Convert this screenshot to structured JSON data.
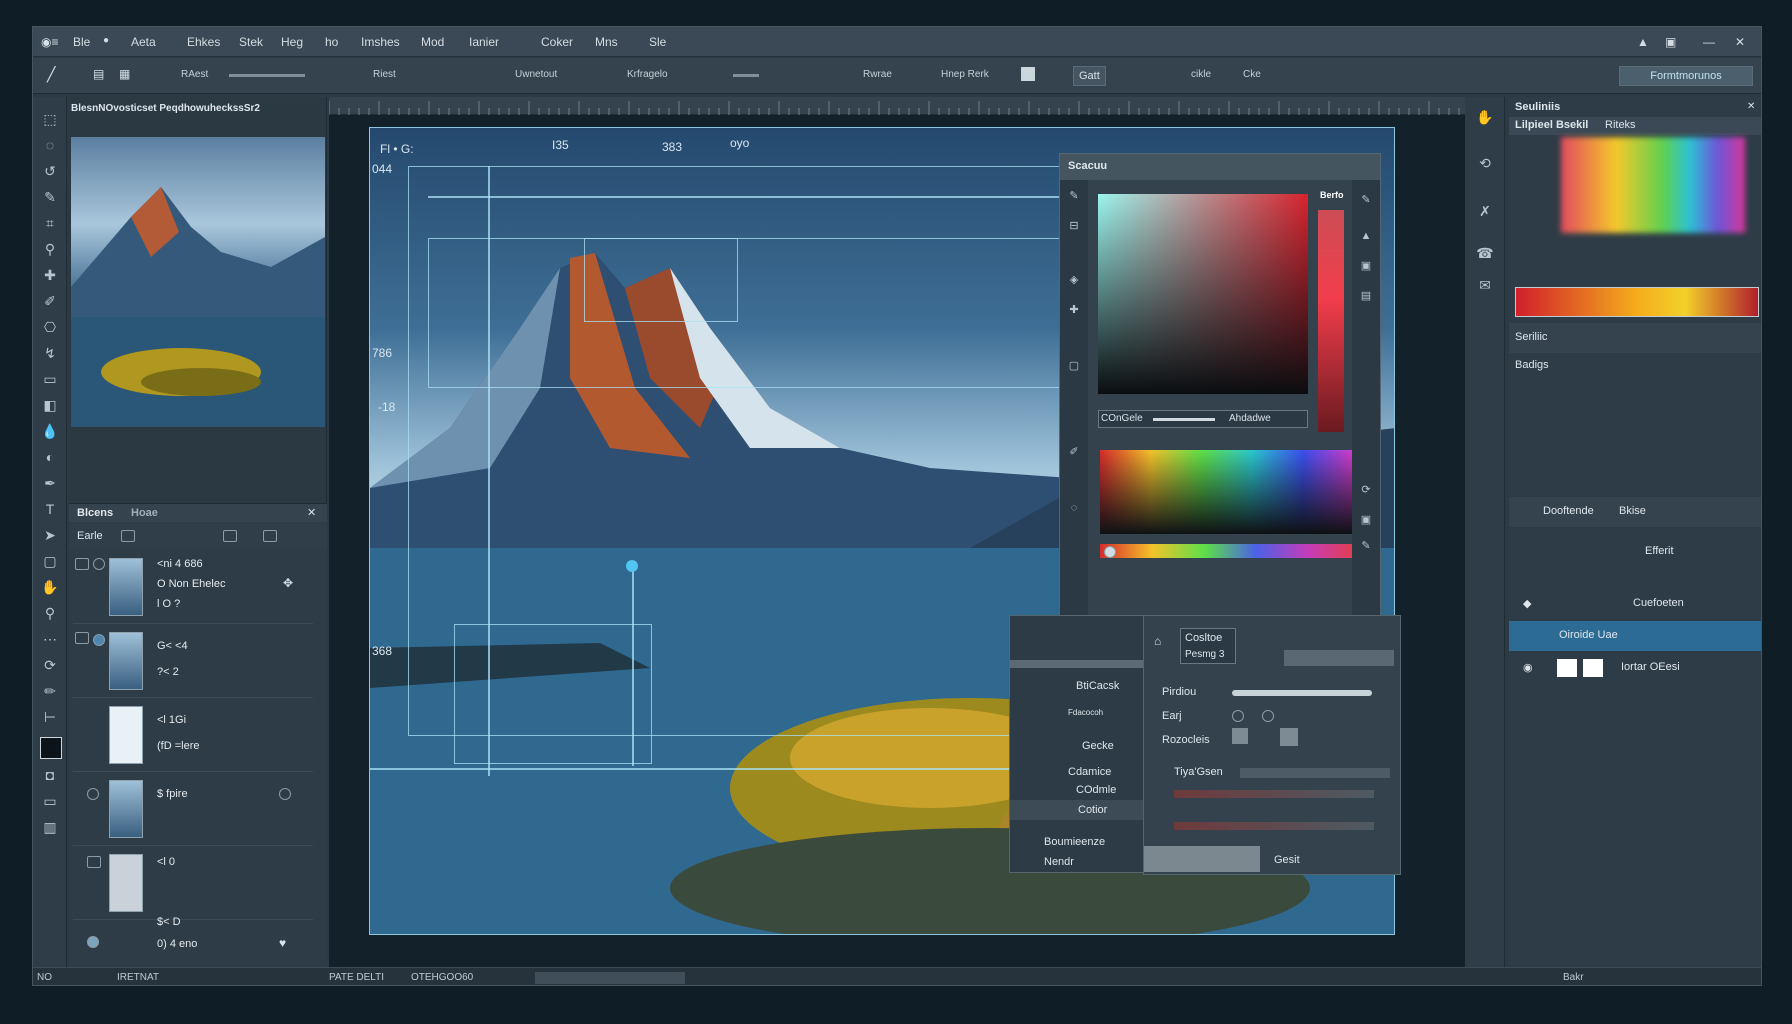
{
  "menu": {
    "items": [
      "Ble",
      "Aeta",
      "Ehkes",
      "Stek",
      "Heg",
      "ho",
      "Imshes",
      "Mod",
      "Ianier",
      "Coker",
      "Mns",
      "Sle"
    ]
  },
  "options": {
    "items": [
      "RAest",
      "Riest",
      "Uwnetout",
      "Krfragelo",
      "Rwrae",
      "Hnep Rerk",
      "Gatt",
      "cikle",
      "Cke"
    ],
    "right_button": "Formtmorunos"
  },
  "navigator": {
    "title": "BlesnNOvosticset PeqdhowuheckssSr2",
    "panel_tab": "Blcens",
    "panel_tab2": "Hoae",
    "filter": "Earle"
  },
  "layers": [
    {
      "line1": "<ni 4 686",
      "line2": "O Non Ehelec",
      "line3": "l O ?"
    },
    {
      "line1": "G< <4",
      "line2": "?< 2",
      "line3": ""
    },
    {
      "line1": "<l 1Gi",
      "line2": "(fD =lere",
      "line3": ""
    },
    {
      "line1": "$ fpire",
      "line2": "",
      "line3": ""
    },
    {
      "line1": "<l 0",
      "line2": "",
      "line3": ""
    },
    {
      "line1": "$< D",
      "line2": "0) 4 eno",
      "line3": ""
    }
  ],
  "canvas": {
    "top_labels": [
      "Fl • G:",
      "I35",
      "383",
      "oyo"
    ],
    "side_labels": [
      "044",
      "786",
      "-18",
      "368"
    ]
  },
  "swatch": {
    "title": "Scacuu",
    "label": "Berfo",
    "field_left": "COnGele",
    "field_right": "Ahdadwe"
  },
  "side_menu": {
    "items": [
      "BtiCacsk",
      "Fdacocoh",
      "Gecke",
      "Cdamice",
      "COdmle",
      "Cotior",
      "Boumieenze",
      "Nendr"
    ]
  },
  "props": {
    "tab": "Cosltoe",
    "sub": "Pesmg 3",
    "row1": "Pirdiou",
    "row2": "Earj",
    "row3": "Rozocleis",
    "row4": "Tiya'Gsen",
    "footer": "Gesit"
  },
  "rightpanel": {
    "title": "Seuliniis",
    "tab1": "Lilpieel Bsekil",
    "tab2": "Riteks",
    "row1": "Seriliic",
    "row2": "Badigs",
    "row3": "Dooftende",
    "row4": "Bkise",
    "row5": "Efferit",
    "row6": "Cuefoeten",
    "sel": "Oiroide Uae",
    "last": "Iortar OEesi"
  },
  "status": {
    "left": "NO",
    "mid": "IRETNAT",
    "info": "PATE DELTI",
    "code": "OTEHGOO60",
    "right": "Bakr"
  },
  "colors": {
    "accent": "#2e6f96",
    "selection": "#2c6b93"
  }
}
